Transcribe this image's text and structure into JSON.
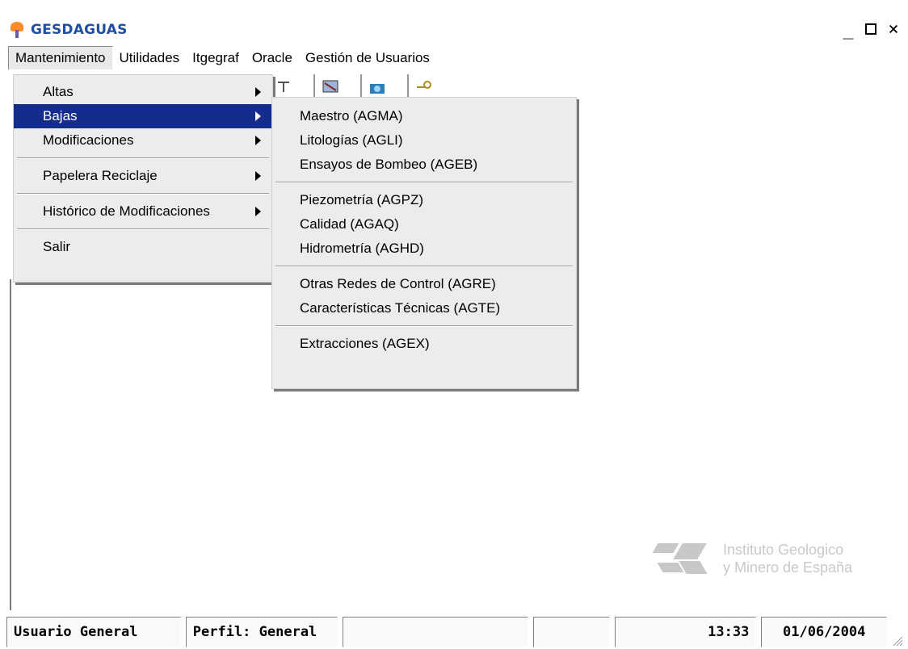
{
  "window": {
    "title": "GESDAGUAS",
    "controls": {
      "minimize": "_",
      "close": "×"
    }
  },
  "menubar": {
    "items": [
      {
        "label": "Mantenimiento"
      },
      {
        "label": "Utilidades"
      },
      {
        "label": "Itgegraf"
      },
      {
        "label": "Oracle"
      },
      {
        "label": "Gestión de Usuarios"
      }
    ]
  },
  "main_menu": {
    "items": [
      {
        "label": "Altas"
      },
      {
        "label": "Bajas"
      },
      {
        "label": "Modificaciones"
      },
      {
        "label": "Papelera Reciclaje"
      },
      {
        "label": "Histórico de Modificaciones"
      },
      {
        "label": "Salir"
      }
    ]
  },
  "submenu": {
    "items": [
      {
        "label": "Maestro (AGMA)"
      },
      {
        "label": "Litologías (AGLI)"
      },
      {
        "label": "Ensayos de Bombeo (AGEB)"
      },
      {
        "label": "Piezometría (AGPZ)"
      },
      {
        "label": "Calidad (AGAQ)"
      },
      {
        "label": "Hidrometría (AGHD)"
      },
      {
        "label": "Otras Redes de Control (AGRE)"
      },
      {
        "label": "Características Técnicas (AGTE)"
      },
      {
        "label": "Extracciones (AGEX)"
      }
    ]
  },
  "watermark": {
    "line1": "Instituto Geologico",
    "line2": "y Minero de España"
  },
  "statusbar": {
    "user": "Usuario General",
    "perfil": "Perfil: General",
    "time": "13:33",
    "date": "01/06/2004"
  },
  "colors": {
    "selection": "#142d8c",
    "title": "#1f4fa0"
  }
}
